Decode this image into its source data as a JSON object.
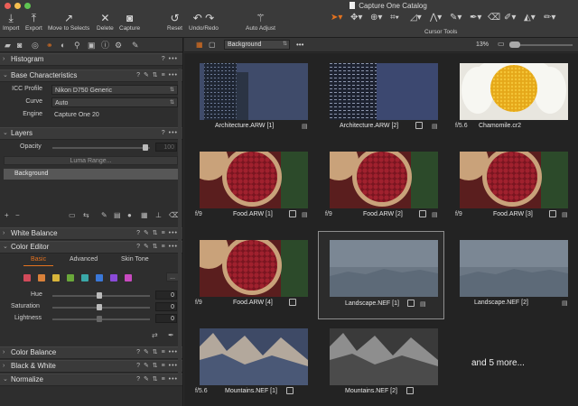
{
  "window": {
    "title": "Capture One Catalog"
  },
  "toolbar": {
    "import": "Import",
    "export": "Export",
    "move_to_selects": "Move to Selects",
    "delete": "Delete",
    "capture": "Capture",
    "reset": "Reset",
    "undo_redo": "Undo/Redo",
    "auto_adjust": "Auto Adjust",
    "cursor_tools": "Cursor Tools"
  },
  "panel": {
    "histogram": {
      "title": "Histogram",
      "actions": "? •••"
    },
    "base": {
      "title": "Base Characteristics",
      "actions": "? ✎ ⇅ ≡ •••",
      "icc_label": "ICC Profile",
      "icc_value": "Nikon D750 Generic",
      "curve_label": "Curve",
      "curve_value": "Auto",
      "engine_label": "Engine",
      "engine_value": "Capture One 20"
    },
    "layers": {
      "title": "Layers",
      "actions": "? •••",
      "opacity_label": "Opacity",
      "opacity_value": "100",
      "luma_range": "Luma Range...",
      "layer_name": "Background"
    },
    "white_balance": {
      "title": "White Balance",
      "actions": "? ✎ ⇅ ≡ •••"
    },
    "color_editor": {
      "title": "Color Editor",
      "actions": "? ✎ ⇅ ≡ •••",
      "tabs": [
        "Basic",
        "Advanced",
        "Skin Tone"
      ],
      "swatch_more": "...",
      "hue_label": "Hue",
      "hue_value": "0",
      "saturation_label": "Saturation",
      "saturation_value": "0",
      "lightness_label": "Lightness",
      "lightness_value": "0",
      "swatches": [
        "#d24a5a",
        "#d9813a",
        "#d8b53a",
        "#6aa83a",
        "#3aa8a8",
        "#3a78d8",
        "#8a4ad8",
        "#c84ac0"
      ]
    },
    "color_balance": {
      "title": "Color Balance",
      "actions": "? ✎ ⇅ ≡ •••"
    },
    "black_white": {
      "title": "Black & White",
      "actions": "? ✎ ⇅ ≡ •••"
    },
    "normalize": {
      "title": "Normalize",
      "actions": "? ✎ ⇅ ≡ •••"
    }
  },
  "viewer": {
    "collection": "Background",
    "zoom": "13%"
  },
  "browser": {
    "items": [
      {
        "fnum": "",
        "name": "Architecture.ARW [1]"
      },
      {
        "fnum": "",
        "name": "Architecture.ARW [2]"
      },
      {
        "fnum": "f/5.6",
        "name": "Chamomile.cr2"
      },
      {
        "fnum": "f/9",
        "name": "Food.ARW [1]"
      },
      {
        "fnum": "f/9",
        "name": "Food.ARW [2]"
      },
      {
        "fnum": "f/9",
        "name": "Food.ARW [3]"
      },
      {
        "fnum": "f/9",
        "name": "Food.ARW [4]"
      },
      {
        "fnum": "",
        "name": "Landscape.NEF [1]"
      },
      {
        "fnum": "",
        "name": "Landscape.NEF [2]"
      },
      {
        "fnum": "f/5.6",
        "name": "Mountains.NEF [1]"
      },
      {
        "fnum": "",
        "name": "Mountains.NEF [2]"
      }
    ],
    "more_text": "and 5 more..."
  },
  "colors": {
    "accent": "#e3721f",
    "panel": "#2e2e2e",
    "browser_bg": "#232323"
  }
}
